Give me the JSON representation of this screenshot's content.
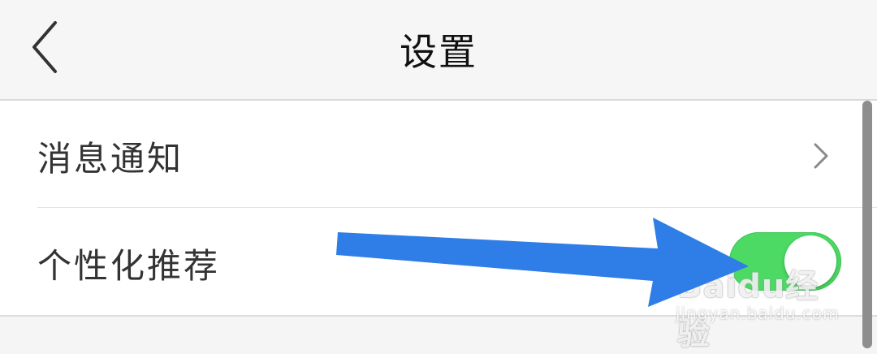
{
  "header": {
    "title": "设置",
    "back_icon": "chevron-left-icon"
  },
  "settings": {
    "items": [
      {
        "label": "消息通知",
        "control": "chevron-right-icon"
      },
      {
        "label": "个性化推荐",
        "control": "toggle",
        "toggle_on": true
      }
    ]
  },
  "colors": {
    "toggle_on": "#4cd964",
    "arrow": "#2f7de6"
  },
  "annotation": {
    "arrow_icon": "arrow-right-icon"
  },
  "watermark": {
    "brand": "Baidu经验",
    "url": "jingyan.baidu.com"
  }
}
